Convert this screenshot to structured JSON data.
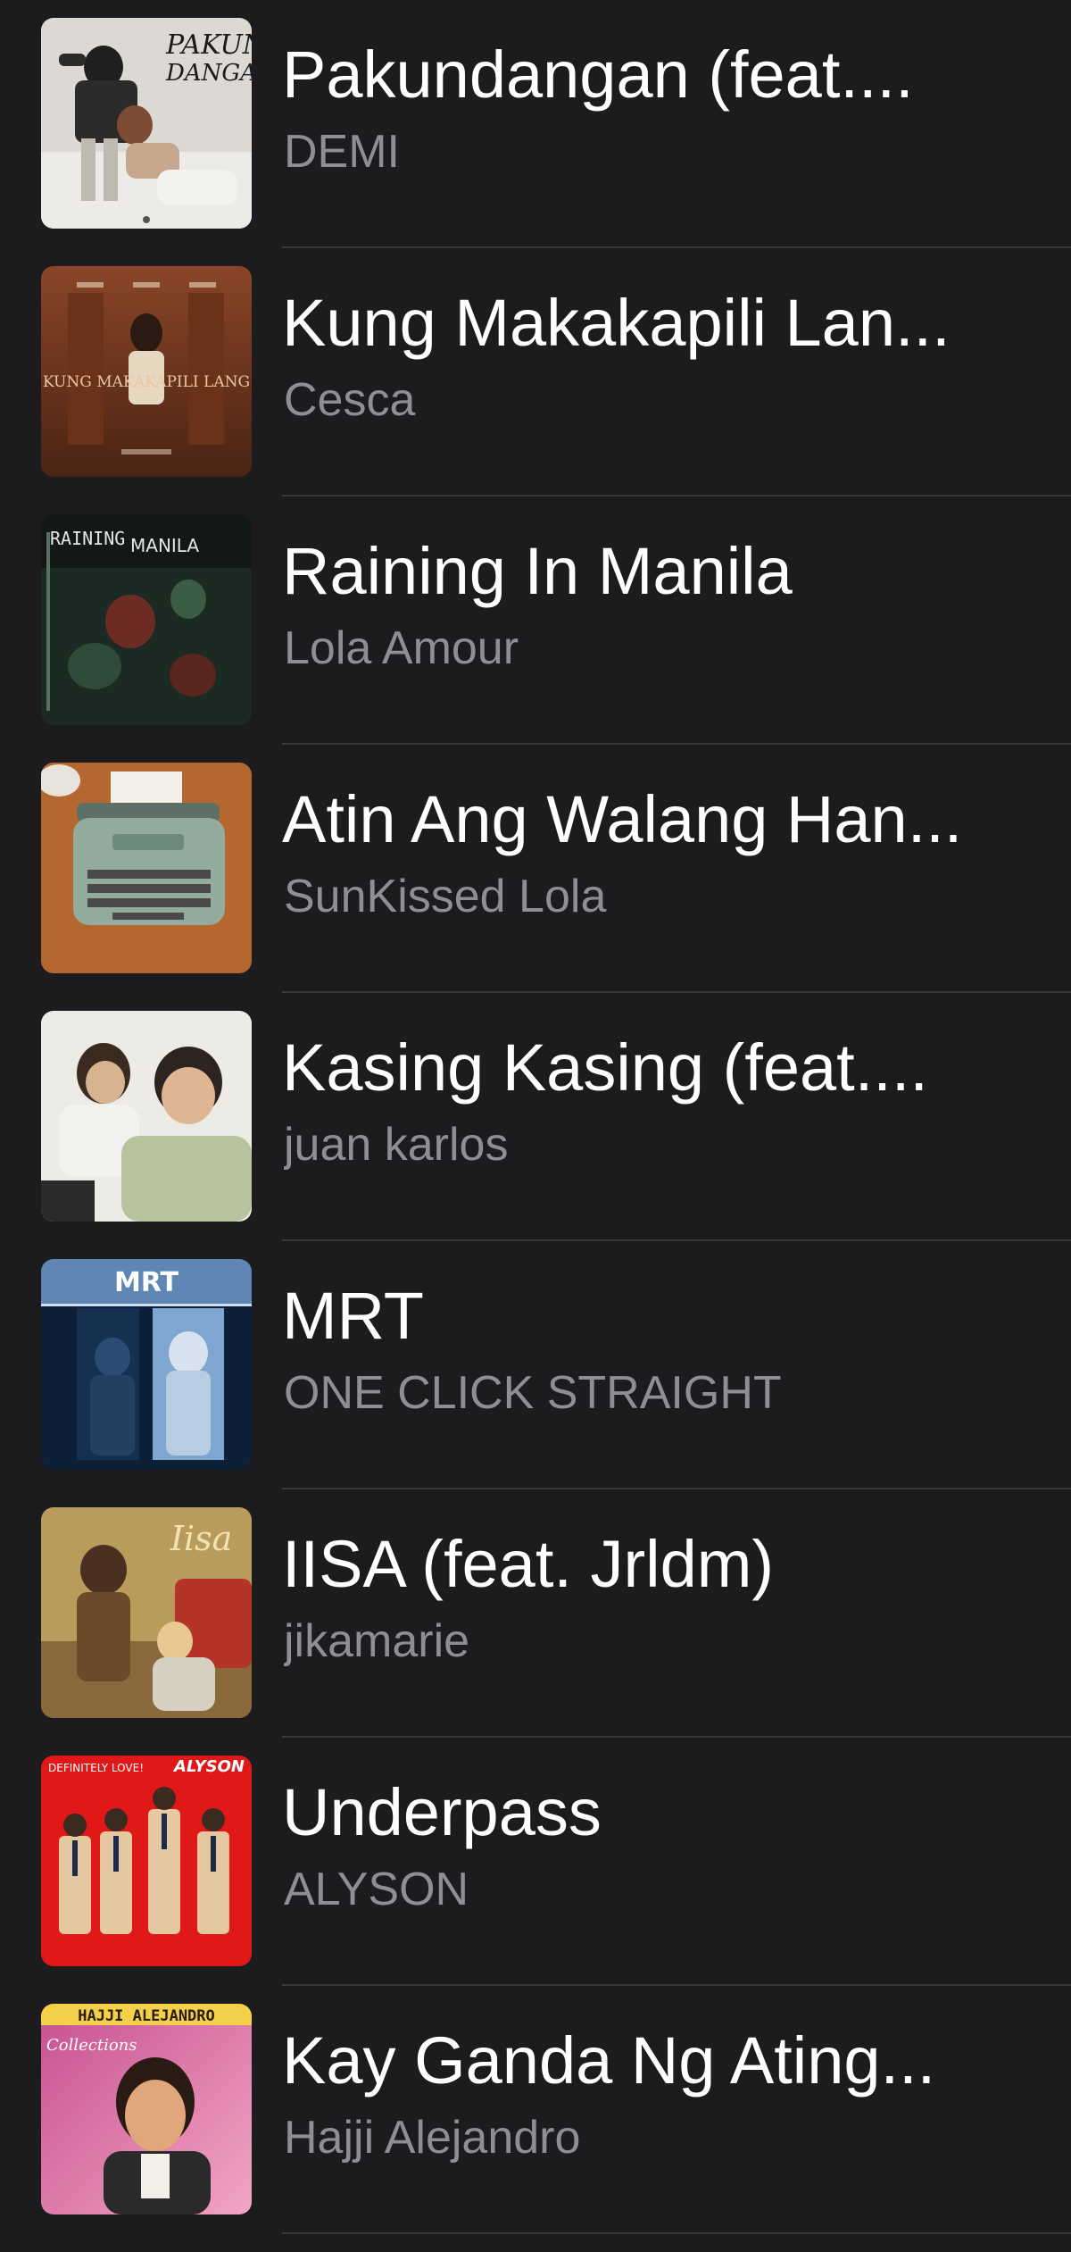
{
  "songs": [
    {
      "title": "Pakundangan (feat....",
      "artist": "DEMI",
      "art_label": "PAKUN DANGAN",
      "art_colors": [
        "#d9d6d2",
        "#2b2b2b",
        "#8a5a44"
      ],
      "art_icon": "album-art-pakundangan"
    },
    {
      "title": "Kung Makakapili Lan...",
      "artist": "Cesca",
      "art_label": "KUNG MAKAKAPILI LANG",
      "art_colors": [
        "#7a3b22",
        "#c9a37a",
        "#3d1d10"
      ],
      "art_icon": "album-art-kung-makakapili-lang"
    },
    {
      "title": "Raining In Manila",
      "artist": "Lola Amour",
      "art_label": "RAINING MANILA",
      "art_colors": [
        "#0f1713",
        "#2f4a36",
        "#7b2a24"
      ],
      "art_icon": "album-art-raining-in-manila"
    },
    {
      "title": "Atin Ang Walang Han...",
      "artist": "SunKissed Lola",
      "art_label": "",
      "art_colors": [
        "#b3682f",
        "#8fa99a",
        "#e9e4da"
      ],
      "art_icon": "album-art-typewriter"
    },
    {
      "title": "Kasing Kasing (feat....",
      "artist": "juan karlos",
      "art_label": "",
      "art_colors": [
        "#e8e4dd",
        "#b7c2a2",
        "#2a2a2a"
      ],
      "art_icon": "album-art-kasing-kasing"
    },
    {
      "title": "MRT",
      "artist": "ONE CLICK STRAIGHT",
      "art_label": "MRT",
      "art_colors": [
        "#0e2038",
        "#6f9ac8",
        "#cfd9e6"
      ],
      "art_icon": "album-art-mrt"
    },
    {
      "title": "IISA (feat. Jrldm)",
      "artist": "jikamarie",
      "art_label": "Iisa",
      "art_colors": [
        "#b89a5a",
        "#6b4a2a",
        "#e2cf9a"
      ],
      "art_icon": "album-art-iisa"
    },
    {
      "title": "Underpass",
      "artist": "ALYSON",
      "art_label": "ALYSON",
      "art_label_2": "DEFINITELY LOVE!",
      "art_colors": [
        "#e01818",
        "#e9c9a0",
        "#1a1a1a"
      ],
      "art_icon": "album-art-underpass"
    },
    {
      "title": "Kay Ganda Ng Ating...",
      "artist": "Hajji Alejandro",
      "art_label": "HAJJI ALEJANDRO",
      "art_label_2": "Collections",
      "art_colors": [
        "#d94a8a",
        "#f2d04a",
        "#2a2a2a"
      ],
      "art_icon": "album-art-hajji-alejandro"
    }
  ]
}
